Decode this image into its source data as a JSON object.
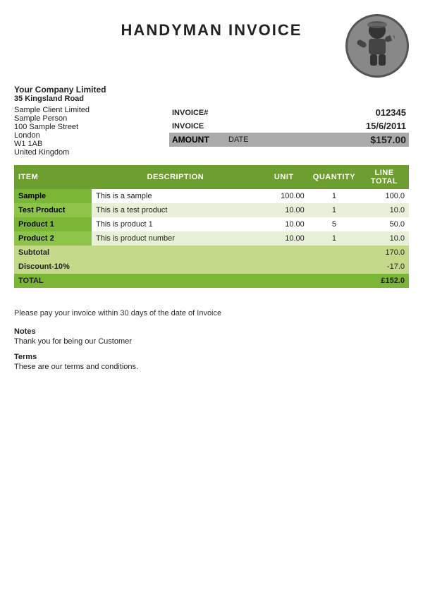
{
  "header": {
    "title": "HANDYMAN INVOICE"
  },
  "company": {
    "name": "Your Company Limited",
    "address_line1": "35 Kingsland Road",
    "address_line2": ""
  },
  "client": {
    "company": "Sample Client Limited",
    "person": "Sample Person",
    "street": "100 Sample Street",
    "city": "London",
    "postcode": "W1 1AB",
    "country": "United Kingdom"
  },
  "invoice": {
    "invoice_hash_label": "INVOICE#",
    "invoice_number": "012345",
    "invoice_label": "INVOICE",
    "invoice_date": "15/6/2011",
    "amount_label": "AMOUNT",
    "amount_date_label": "DATE",
    "amount_value": "$157.00"
  },
  "table": {
    "headers": [
      "ITEM",
      "DESCRIPTION",
      "UNIT",
      "QUANTITY",
      "LINE TOTAL"
    ],
    "rows": [
      {
        "name": "Sample",
        "description": "This is a sample",
        "unit": "100.00",
        "quantity": "1",
        "line_total": "100.0",
        "alt": false
      },
      {
        "name": "Test Product",
        "description": "This is a test product",
        "unit": "10.00",
        "quantity": "1",
        "line_total": "10.0",
        "alt": true
      },
      {
        "name": "Product 1",
        "description": "This is product 1",
        "unit": "10.00",
        "quantity": "5",
        "line_total": "50.0",
        "alt": false
      },
      {
        "name": "Product 2",
        "description": "This is product number",
        "unit": "10.00",
        "quantity": "1",
        "line_total": "10.0",
        "alt": true
      }
    ],
    "subtotal_label": "Subtotal",
    "subtotal_value": "170.0",
    "discount_label": "Discount-10%",
    "discount_value": "-17.0",
    "total_label": "TOTAL",
    "total_value": "£152.0"
  },
  "footer": {
    "payment_text": "Please pay your invoice within 30 days of the date of Invoice",
    "notes_title": "Notes",
    "notes_text": "Thank you for being our Customer",
    "terms_title": "Terms",
    "terms_text": "These are our terms and conditions."
  }
}
